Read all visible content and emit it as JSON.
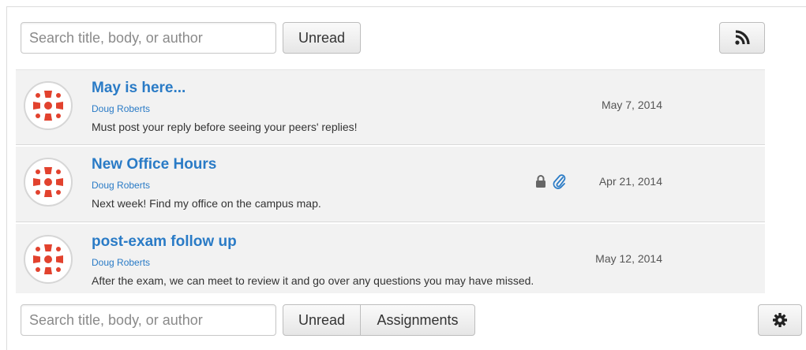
{
  "top_toolbar": {
    "search_placeholder": "Search title, body, or author",
    "unread_label": "Unread",
    "rss_icon": "rss-icon"
  },
  "discussions": [
    {
      "title": "May is here...",
      "author": "Doug Roberts",
      "message": "Must post your reply before seeing your peers' replies!",
      "date": "May 7, 2014",
      "icons": []
    },
    {
      "title": "New Office Hours",
      "author": "Doug Roberts",
      "message": "Next week! Find my office on the campus map.",
      "date": "Apr 21, 2014",
      "icons": [
        "lock-icon",
        "paperclip-icon"
      ]
    },
    {
      "title": "post-exam follow up",
      "author": "Doug Roberts",
      "message": "After the exam, we can meet to review it and go over any questions you may have missed.",
      "date": "May 12, 2014",
      "icons": []
    }
  ],
  "bottom_toolbar": {
    "search_placeholder": "Search title, body, or author",
    "unread_label": "Unread",
    "assignments_label": "Assignments",
    "settings_icon": "gear-icon"
  },
  "colors": {
    "link": "#2a7bc6",
    "avatar_red": "#e2422e",
    "row_bg": "#f2f2f2"
  }
}
